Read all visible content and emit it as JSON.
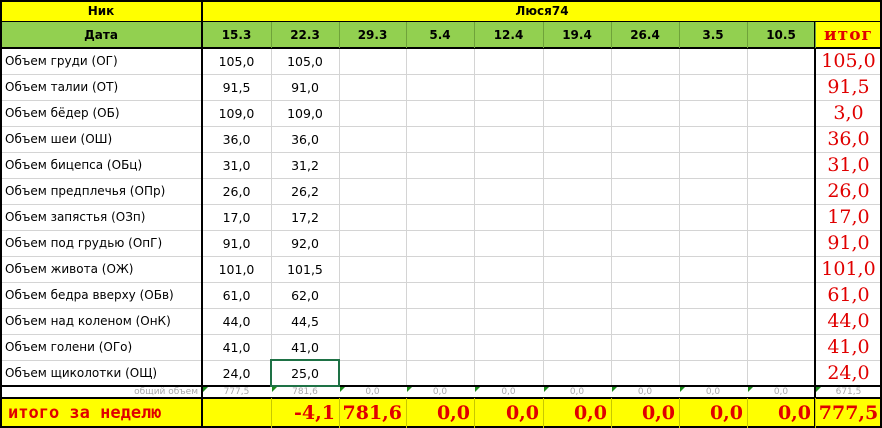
{
  "header": {
    "nick_label": "Ник",
    "user_name": "Люся74",
    "date_label": "Дата",
    "dates": [
      "15.3",
      "22.3",
      "29.3",
      "5.4",
      "12.4",
      "19.4",
      "26.4",
      "3.5",
      "10.5"
    ],
    "total_label": "итог"
  },
  "rows": [
    {
      "label": "Объем груди (ОГ)",
      "v1": "105,0",
      "v2": "105,0",
      "total": "105,0"
    },
    {
      "label": "Объем талии (ОТ)",
      "v1": "91,5",
      "v2": "91,0",
      "total": "91,5"
    },
    {
      "label": "Объем бёдер (ОБ)",
      "v1": "109,0",
      "v2": "109,0",
      "total": "3,0"
    },
    {
      "label": "Объем шеи (ОШ)",
      "v1": "36,0",
      "v2": "36,0",
      "total": "36,0"
    },
    {
      "label": "Объем бицепса (ОБц)",
      "v1": "31,0",
      "v2": "31,2",
      "total": "31,0"
    },
    {
      "label": "Объем предплечья (ОПр)",
      "v1": "26,0",
      "v2": "26,2",
      "total": "26,0"
    },
    {
      "label": "Объем запястья (ОЗп)",
      "v1": "17,0",
      "v2": "17,2",
      "total": "17,0"
    },
    {
      "label": "Объем под грудью (ОпГ)",
      "v1": "91,0",
      "v2": "92,0",
      "total": "91,0"
    },
    {
      "label": "Объем живота (ОЖ)",
      "v1": "101,0",
      "v2": "101,5",
      "total": "101,0"
    },
    {
      "label": "Объем бедра вверху (ОБв)",
      "v1": "61,0",
      "v2": "62,0",
      "total": "61,0"
    },
    {
      "label": "Объем над коленом (ОнК)",
      "v1": "44,0",
      "v2": "44,5",
      "total": "44,0"
    },
    {
      "label": "Объем голени (ОГо)",
      "v1": "41,0",
      "v2": "41,0",
      "total": "41,0"
    },
    {
      "label": "Объем щиколотки (ОЩ)",
      "v1": "24,0",
      "v2": "25,0",
      "total": "24,0"
    }
  ],
  "volume_row": {
    "label": "общий объем",
    "values": [
      "777,5",
      "781,6",
      "0,0",
      "0,0",
      "0,0",
      "0,0",
      "0,0",
      "0,0",
      "0,0"
    ],
    "total": "671,5"
  },
  "weekly_total": {
    "label": "итого за неделю",
    "values": [
      "",
      "-4,1",
      "781,6",
      "0,0",
      "0,0",
      "0,0",
      "0,0",
      "0,0",
      "0,0"
    ],
    "total": "777,5"
  },
  "colors": {
    "header_yellow": "#ffff00",
    "header_green": "#92d050",
    "total_red": "#e00000",
    "selection_green": "#1e7145"
  }
}
